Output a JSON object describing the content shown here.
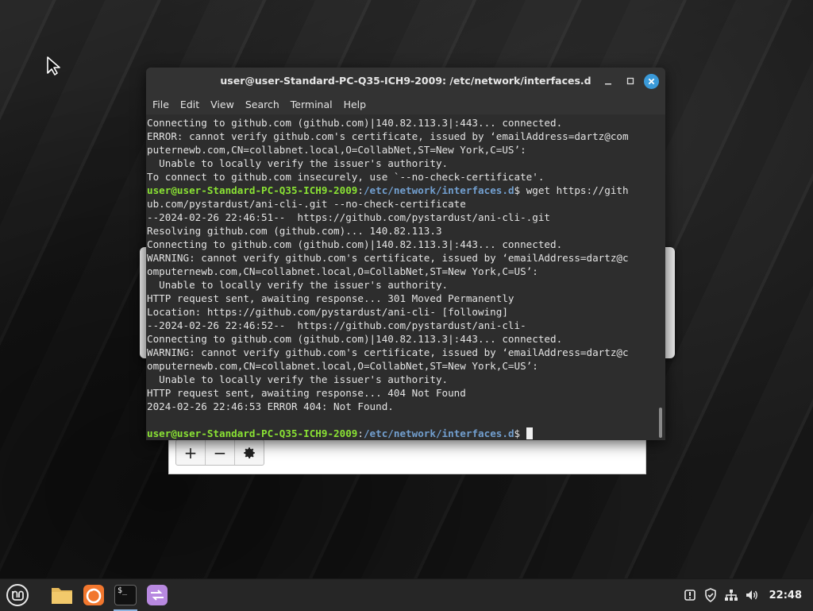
{
  "terminal": {
    "title": "user@user-Standard-PC-Q35-ICH9-2009: /etc/network/interfaces.d",
    "menu": [
      "File",
      "Edit",
      "View",
      "Search",
      "Terminal",
      "Help"
    ],
    "lines": {
      "l1": "Connecting to github.com (github.com)|140.82.113.3|:443... connected.",
      "l2": "ERROR: cannot verify github.com's certificate, issued by ‘emailAddress=dartz@com",
      "l3": "puternewb.com,CN=collabnet.local,O=CollabNet,ST=New York,C=US’:",
      "l4": "  Unable to locally verify the issuer's authority.",
      "l5": "To connect to github.com insecurely, use `--no-check-certificate'.",
      "l6_user": "user@user-Standard-PC-Q35-ICH9-2009",
      "l6_sep": ":",
      "l6_path": "/etc/network/interfaces.d",
      "l6_cmd": "$ wget https://gith",
      "l7": "ub.com/pystardust/ani-cli-.git --no-check-certificate",
      "l8": "--2024-02-26 22:46:51--  https://github.com/pystardust/ani-cli-.git",
      "l9": "Resolving github.com (github.com)... 140.82.113.3",
      "l10": "Connecting to github.com (github.com)|140.82.113.3|:443... connected.",
      "l11": "WARNING: cannot verify github.com's certificate, issued by ‘emailAddress=dartz@c",
      "l12": "omputernewb.com,CN=collabnet.local,O=CollabNet,ST=New York,C=US’:",
      "l13": "  Unable to locally verify the issuer's authority.",
      "l14": "HTTP request sent, awaiting response... 301 Moved Permanently",
      "l15": "Location: https://github.com/pystardust/ani-cli- [following]",
      "l16": "--2024-02-26 22:46:52--  https://github.com/pystardust/ani-cli-",
      "l17": "Connecting to github.com (github.com)|140.82.113.3|:443... connected.",
      "l18": "WARNING: cannot verify github.com's certificate, issued by ‘emailAddress=dartz@c",
      "l19": "omputernewb.com,CN=collabnet.local,O=CollabNet,ST=New York,C=US’:",
      "l20": "  Unable to locally verify the issuer's authority.",
      "l21": "HTTP request sent, awaiting response... 404 Not Found",
      "l22": "2024-02-26 22:46:53 ERROR 404: Not Found.",
      "l23": "",
      "l24_user": "user@user-Standard-PC-Q35-ICH9-2009",
      "l24_sep": ":",
      "l24_path": "/etc/network/interfaces.d",
      "l24_cmd": "$ "
    },
    "colors": {
      "prompt_user": "#8ae234",
      "prompt_path": "#729fcf",
      "background": "#2d2d2d"
    }
  },
  "background_dialog": {
    "toolbar": {
      "add": "+",
      "remove": "−",
      "settings_icon": "gear-icon"
    }
  },
  "taskbar": {
    "menu_icon": "linux-mint-menu-icon",
    "apps": [
      "files-icon",
      "firefox-icon",
      "terminal-icon",
      "warpinator-icon"
    ],
    "terminal_glyph": "$_",
    "tray_icons": [
      "update-manager-icon",
      "shield-icon",
      "network-icon",
      "volume-icon"
    ],
    "clock": "22:48"
  }
}
